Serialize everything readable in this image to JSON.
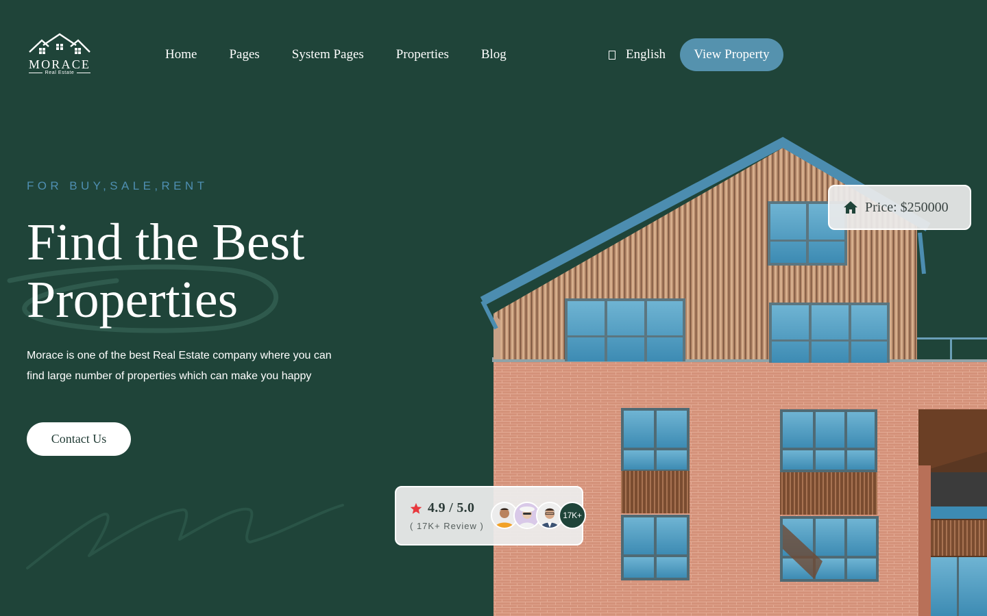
{
  "brand": {
    "name": "MORACE",
    "tagline": "Real Estate",
    "icon": "houses-logo-icon"
  },
  "nav": {
    "items": [
      {
        "label": "Home"
      },
      {
        "label": "Pages"
      },
      {
        "label": "System Pages"
      },
      {
        "label": "Properties"
      },
      {
        "label": "Blog"
      }
    ],
    "language": {
      "icon": "globe-icon",
      "label": "English"
    },
    "cta_label": "View Property"
  },
  "hero": {
    "eyebrow": "FOR BUY,SALE,RENT",
    "title_line1": "Find the Best",
    "title_line2": "Properties",
    "description": "Morace is one of the best Real Estate company where you can find large number of properties which can make you happy",
    "contact_label": "Contact Us"
  },
  "price_card": {
    "icon": "home-icon",
    "text": "Price: $250000"
  },
  "rating_card": {
    "icon": "star-icon",
    "rating": "4.9 / 5.0",
    "reviews": "( 17K+ Review )",
    "avatars": [
      "reviewer-1",
      "reviewer-2",
      "reviewer-3"
    ],
    "count_badge": "17K+"
  },
  "colors": {
    "background": "#1f4439",
    "accent_blue": "#5592ae",
    "eyebrow_blue": "#4f8fb2",
    "star_red": "#e8383d",
    "brick": "#d38f76"
  }
}
